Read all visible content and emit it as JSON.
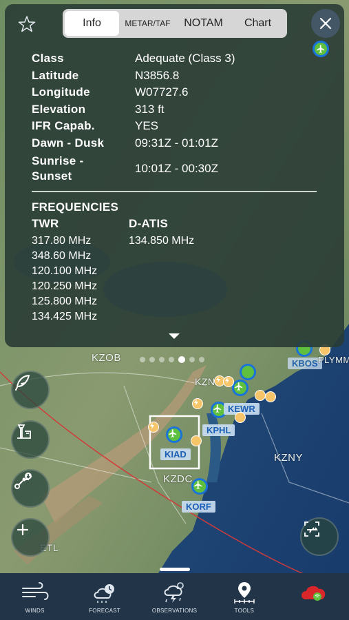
{
  "tabs": [
    {
      "label": "Info",
      "active": true
    },
    {
      "label": "METAR/TAF",
      "active": false
    },
    {
      "label": "NOTAM",
      "active": false
    },
    {
      "label": "Chart",
      "active": false
    }
  ],
  "info": [
    {
      "key": "Class",
      "value": "Adequate (Class 3)"
    },
    {
      "key": "Latitude",
      "value": "N3856.8"
    },
    {
      "key": "Longitude",
      "value": "W07727.6"
    },
    {
      "key": "Elevation",
      "value": "313 ft"
    },
    {
      "key": "IFR Capab.",
      "value": "YES"
    },
    {
      "key": "Dawn - Dusk",
      "value": "09:31Z - 01:01Z"
    },
    {
      "key": "Sunrise - Sunset",
      "value": "10:01Z - 00:30Z"
    }
  ],
  "frequencies": {
    "title": "FREQUENCIES",
    "twr": {
      "header": "TWR",
      "values": [
        "317.80 MHz",
        "348.60 MHz",
        "120.100 MHz",
        "120.250 MHz",
        "125.800 MHz",
        "134.425 MHz"
      ]
    },
    "datis": {
      "header": "D-ATIS",
      "values": [
        "134.850 MHz"
      ]
    }
  },
  "map": {
    "regions": [
      "KZOB",
      "KZNY",
      "KZDC",
      "KZN",
      "ETL"
    ],
    "airports": [
      "KIAD",
      "KPHL",
      "KEWR",
      "KORF"
    ],
    "clipped_labels": [
      "KBOS",
      "PLYMM"
    ]
  },
  "pager": {
    "count": 6,
    "active_index": 3
  },
  "bottom_nav": [
    {
      "label": "WINDS",
      "icon": "wind-icon"
    },
    {
      "label": "FORECAST",
      "icon": "forecast-cloud-icon"
    },
    {
      "label": "OBSERVATIONS",
      "icon": "observation-storm-icon"
    },
    {
      "label": "TOOLS",
      "icon": "tools-pin-icon"
    },
    {
      "label": "",
      "icon": "weather-sync-cloud-icon"
    }
  ],
  "colors": {
    "accent_blue": "#1a73d9",
    "airport_green": "#5fbf3f",
    "panel": "#283a34",
    "tabbar": "#223447",
    "cloud_red": "#d9262b"
  }
}
